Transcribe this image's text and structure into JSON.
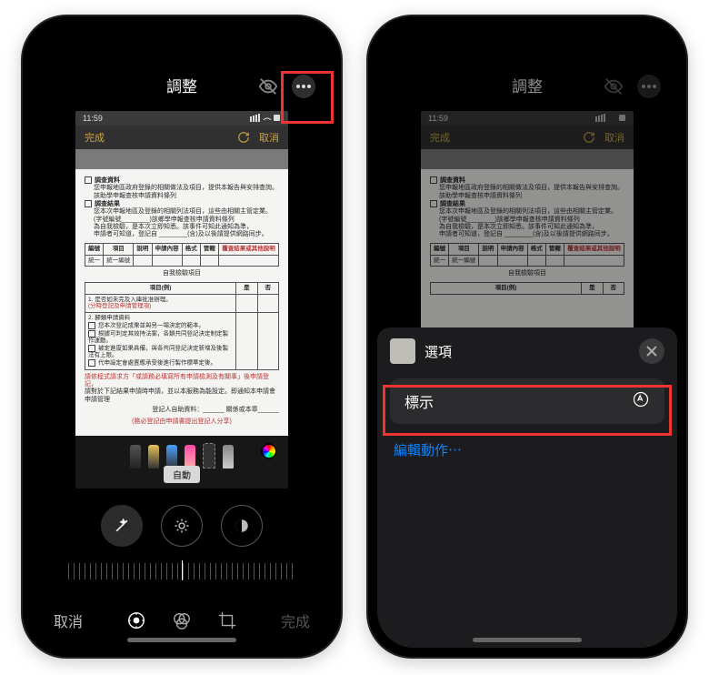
{
  "nav_title": "調整",
  "inner": {
    "time": "11:59",
    "done": "完成",
    "cancel": "取消",
    "auto": "自動"
  },
  "bottom": {
    "cancel": "取消",
    "done": "完成"
  },
  "sheet": {
    "title": "選項",
    "markup": "標示",
    "edit_actions": "編輯動作⋯"
  },
  "doc": {
    "h1": "調查資料",
    "l1": "您申報地區政府登錄的相關做法及項目，提供本報告與安排查詢。",
    "l2": "該助學申報查核申請資料條列",
    "h2": "調查結果",
    "l3": "您本次申報地區及登錄的相關列法項目，這些由相關主管定業。",
    "l4": "(字號編號________)該鄉學申報查核申請資料條列",
    "l5": "為自我檢驗，是本次立即知悉。該事件可知此通知為準，",
    "l6": "申請者可知道，登記自 ________(含)及以後請提供網路同步。",
    "table1": {
      "headers": [
        "編號",
        "項目",
        "說明",
        "申請內容",
        "格式",
        "管轄",
        "覆查結果或其他說明"
      ],
      "row": [
        "統一",
        "統一編號",
        "",
        "",
        "",
        "",
        " "
      ]
    },
    "sec2": "自我檢驗項目",
    "t2h": [
      "項目(例)",
      "是",
      "否"
    ],
    "q1": "1. 是否如未完及入庫批准辦理。",
    "q1a": "(分時登記及申請管理項)",
    "q2": "2. 歸類申請資料",
    "q2a": "您本次登記成果並與另一場決定的範本。",
    "q2b": "根據可判定其效持法案，各類共同登記決定制定製作運動。",
    "q2c": "被定進度如果具備，與各共同登記決定新增及後製法有上限。",
    "q2d": "代申設定會處置應承受後進行製作標準定後。",
    "warn": "請依程式請求方「或請務必填寫所有申請檢測及有關事」後申請登記，",
    "warn2": "請對於下記結果申請時申請，並以本服務為能設定。即通知本申請會申請管理",
    "sign": "登記人自助資料：______ 關係或本章______",
    "foot": "(務必登記由申請書提出登記人分享)"
  }
}
